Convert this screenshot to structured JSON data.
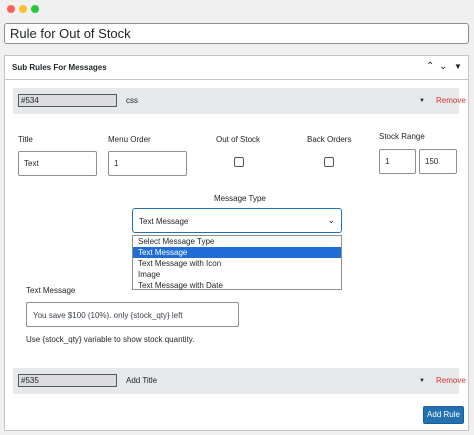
{
  "rule_title": "Rule for Out of Stock",
  "panel": {
    "title": "Sub Rules For Messages",
    "up_icon": "chevron-up-icon",
    "down_icon": "chevron-down-icon",
    "toggle_icon": "caret-down-icon",
    "up_glyph": "⌃",
    "down_glyph": "⌄",
    "toggle_glyph": "▼"
  },
  "sub_rules": [
    {
      "id": "#534",
      "name": "css",
      "remove": "Remove",
      "caret": "▼"
    },
    {
      "id": "#535",
      "name": "Add Title",
      "remove": "Remove",
      "caret": "▼"
    }
  ],
  "form": {
    "title_label": "Title",
    "title_value": "Text",
    "menu_order_label": "Menu Order",
    "menu_order_value": "1",
    "out_of_stock_label": "Out of Stock",
    "out_of_stock_checked": false,
    "back_orders_label": "Back Orders",
    "back_orders_checked": false,
    "stock_range_label": "Stock Range",
    "stock_range_min": "1",
    "stock_range_max": "150",
    "message_type_label": "Message Type",
    "message_type_value": "Text Message",
    "message_type_chevron": "⌄",
    "message_type_options": [
      "Select Message Type",
      "Text Message",
      "Text Message with Icon",
      "Image",
      "Text Message with Date"
    ],
    "selected_option_index": 1,
    "text_message_label": "Text Message",
    "text_message_value": "You save $100 (10%). only {stock_qty} left",
    "help_text": "Use {stock_qty} variable to show stock quantity."
  },
  "add_rule_label": "Add Rule",
  "colors": {
    "accent": "#2271b1",
    "highlight": "#1e6cd4",
    "remove": "#d63638",
    "window_close": "#ff5f57",
    "window_minimize": "#febc2e",
    "window_maximize": "#28c840"
  }
}
